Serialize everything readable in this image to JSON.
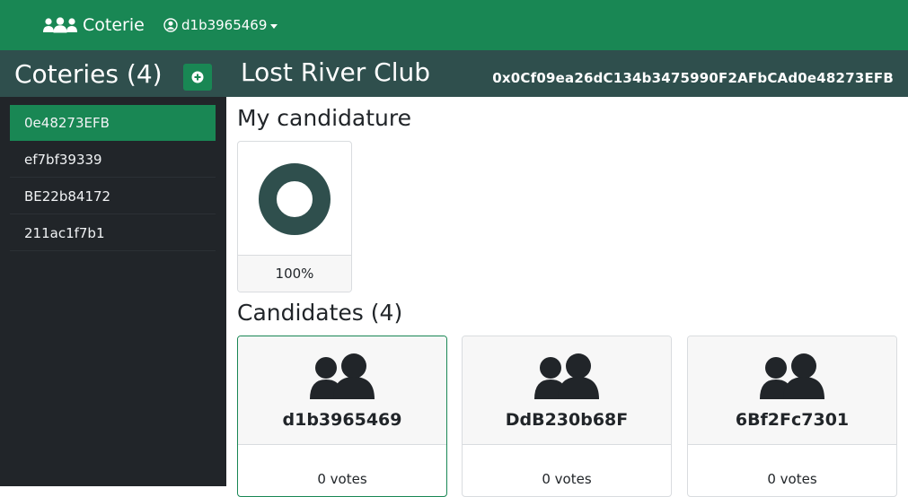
{
  "navbar": {
    "brand_label": "Coterie",
    "user_label": "d1b3965469",
    "background": "#198754"
  },
  "sidebar": {
    "title": "Coteries (4)",
    "add_icon": "plus-circle-icon",
    "items": [
      {
        "label": "0e48273EFB",
        "active": true
      },
      {
        "label": "ef7bf39339",
        "active": false
      },
      {
        "label": "BE22b84172",
        "active": false
      },
      {
        "label": "211ac1f7b1",
        "active": false
      }
    ]
  },
  "club": {
    "name": "Lost River Club",
    "address": "0x0Cf09ea26dC134b3475990F2AFbCAd0e48273EFB"
  },
  "my_candidature": {
    "title": "My candidature",
    "percent_label": "100%",
    "percent_value": 100,
    "ring_color": "#2f4f4d"
  },
  "candidates": {
    "title": "Candidates (4)",
    "items": [
      {
        "name": "d1b3965469",
        "votes": "0 votes",
        "icon": "users-icon",
        "active": true
      },
      {
        "name": "DdB230b68F",
        "votes": "0 votes",
        "icon": "users-icon",
        "active": false
      },
      {
        "name": "6Bf2Fc7301",
        "votes": "0 votes",
        "icon": "users-icon",
        "active": false
      }
    ]
  }
}
